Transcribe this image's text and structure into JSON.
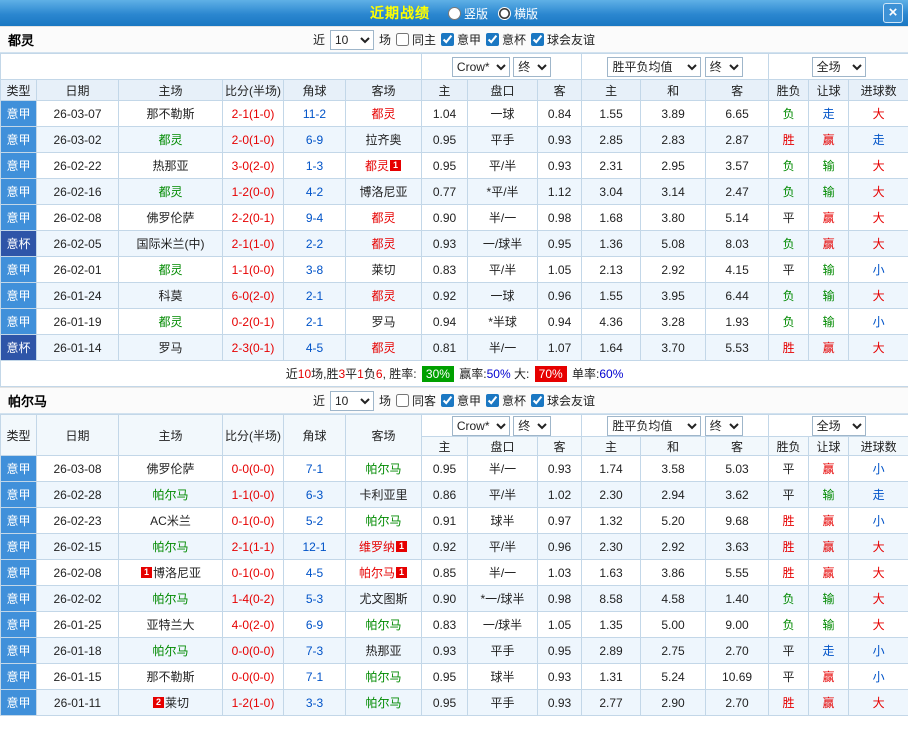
{
  "titlebar": {
    "title": "近期战绩",
    "vertical_label": "竖版",
    "horizontal_label": "横版",
    "horizontal_checked": true,
    "vertical_checked": false,
    "close_glyph": "×"
  },
  "colors": {
    "bar_blue": "#1a77c2",
    "title_yellow": "#ffff00",
    "league_badge": "#4090da",
    "cup_badge": "#2e55a8",
    "win_red": "#e60000",
    "loss_green": "#008a00",
    "link_blue": "#0053c8"
  },
  "sections": [
    {
      "team": "都灵",
      "filters": {
        "near": "近",
        "count": "10",
        "games": "场",
        "same": "同主",
        "same_checked": false,
        "league": "意甲",
        "league_checked": true,
        "cup": "意杯",
        "cup_checked": true,
        "friendly": "球会友谊",
        "friendly_checked": true
      },
      "dropdowns": {
        "company": "Crow*",
        "final1": "终",
        "avg": "胜平负均值",
        "final2": "终",
        "scope": "全场"
      },
      "columns": [
        "类型",
        "日期",
        "主场",
        "比分(半场)",
        "角球",
        "客场",
        "主",
        "盘口",
        "客",
        "主",
        "和",
        "客",
        "胜负",
        "让球",
        "进球数"
      ],
      "rows": [
        {
          "type": "意甲",
          "type_cls": "league",
          "date": "26-03-07",
          "home": "那不勒斯",
          "home_c": "black",
          "home_badge": "",
          "score": "2-1(1-0)",
          "corner": "11-2",
          "away": "都灵",
          "away_c": "red",
          "away_badge": "",
          "h": "1.04",
          "line": "一球",
          "a": "0.84",
          "w": "1.55",
          "d": "3.89",
          "l": "6.65",
          "res": "负",
          "res_c": "green",
          "hcp": "走",
          "hcp_c": "blue",
          "ou": "大",
          "ou_c": "red"
        },
        {
          "type": "意甲",
          "type_cls": "league",
          "date": "26-03-02",
          "home": "都灵",
          "home_c": "green",
          "home_badge": "",
          "score": "2-0(1-0)",
          "corner": "6-9",
          "away": "拉齐奥",
          "away_c": "black",
          "away_badge": "",
          "h": "0.95",
          "line": "平手",
          "a": "0.93",
          "w": "2.85",
          "d": "2.83",
          "l": "2.87",
          "res": "胜",
          "res_c": "red",
          "hcp": "赢",
          "hcp_c": "red",
          "ou": "走",
          "ou_c": "blue"
        },
        {
          "type": "意甲",
          "type_cls": "league",
          "date": "26-02-22",
          "home": "热那亚",
          "home_c": "black",
          "home_badge": "",
          "score": "3-0(2-0)",
          "corner": "1-3",
          "away": "都灵",
          "away_c": "red",
          "away_badge": "1",
          "h": "0.95",
          "line": "平/半",
          "a": "0.93",
          "w": "2.31",
          "d": "2.95",
          "l": "3.57",
          "res": "负",
          "res_c": "green",
          "hcp": "输",
          "hcp_c": "green",
          "ou": "大",
          "ou_c": "red"
        },
        {
          "type": "意甲",
          "type_cls": "league",
          "date": "26-02-16",
          "home": "都灵",
          "home_c": "green",
          "home_badge": "",
          "score": "1-2(0-0)",
          "corner": "4-2",
          "away": "博洛尼亚",
          "away_c": "black",
          "away_badge": "",
          "h": "0.77",
          "line": "*平/半",
          "a": "1.12",
          "w": "3.04",
          "d": "3.14",
          "l": "2.47",
          "res": "负",
          "res_c": "green",
          "hcp": "输",
          "hcp_c": "green",
          "ou": "大",
          "ou_c": "red"
        },
        {
          "type": "意甲",
          "type_cls": "league",
          "date": "26-02-08",
          "home": "佛罗伦萨",
          "home_c": "black",
          "home_badge": "",
          "score": "2-2(0-1)",
          "corner": "9-4",
          "away": "都灵",
          "away_c": "red",
          "away_badge": "",
          "h": "0.90",
          "line": "半/一",
          "a": "0.98",
          "w": "1.68",
          "d": "3.80",
          "l": "5.14",
          "res": "平",
          "res_c": "black",
          "hcp": "赢",
          "hcp_c": "red",
          "ou": "大",
          "ou_c": "red"
        },
        {
          "type": "意杯",
          "type_cls": "cup",
          "date": "26-02-05",
          "home": "国际米兰(中)",
          "home_c": "black",
          "home_badge": "",
          "score": "2-1(1-0)",
          "corner": "2-2",
          "away": "都灵",
          "away_c": "red",
          "away_badge": "",
          "h": "0.93",
          "line": "一/球半",
          "a": "0.95",
          "w": "1.36",
          "d": "5.08",
          "l": "8.03",
          "res": "负",
          "res_c": "green",
          "hcp": "赢",
          "hcp_c": "red",
          "ou": "大",
          "ou_c": "red"
        },
        {
          "type": "意甲",
          "type_cls": "league",
          "date": "26-02-01",
          "home": "都灵",
          "home_c": "green",
          "home_badge": "",
          "score": "1-1(0-0)",
          "corner": "3-8",
          "away": "莱切",
          "away_c": "black",
          "away_badge": "",
          "h": "0.83",
          "line": "平/半",
          "a": "1.05",
          "w": "2.13",
          "d": "2.92",
          "l": "4.15",
          "res": "平",
          "res_c": "black",
          "hcp": "输",
          "hcp_c": "green",
          "ou": "小",
          "ou_c": "blue"
        },
        {
          "type": "意甲",
          "type_cls": "league",
          "date": "26-01-24",
          "home": "科莫",
          "home_c": "black",
          "home_badge": "",
          "score": "6-0(2-0)",
          "corner": "2-1",
          "away": "都灵",
          "away_c": "red",
          "away_badge": "",
          "h": "0.92",
          "line": "一球",
          "a": "0.96",
          "w": "1.55",
          "d": "3.95",
          "l": "6.44",
          "res": "负",
          "res_c": "green",
          "hcp": "输",
          "hcp_c": "green",
          "ou": "大",
          "ou_c": "red"
        },
        {
          "type": "意甲",
          "type_cls": "league",
          "date": "26-01-19",
          "home": "都灵",
          "home_c": "green",
          "home_badge": "",
          "score": "0-2(0-1)",
          "corner": "2-1",
          "away": "罗马",
          "away_c": "black",
          "away_badge": "",
          "h": "0.94",
          "line": "*半球",
          "a": "0.94",
          "w": "4.36",
          "d": "3.28",
          "l": "1.93",
          "res": "负",
          "res_c": "green",
          "hcp": "输",
          "hcp_c": "green",
          "ou": "小",
          "ou_c": "blue"
        },
        {
          "type": "意杯",
          "type_cls": "cup",
          "date": "26-01-14",
          "home": "罗马",
          "home_c": "black",
          "home_badge": "",
          "score": "2-3(0-1)",
          "corner": "4-5",
          "away": "都灵",
          "away_c": "red",
          "away_badge": "",
          "h": "0.81",
          "line": "半/一",
          "a": "1.07",
          "w": "1.64",
          "d": "3.70",
          "l": "5.53",
          "res": "胜",
          "res_c": "red",
          "hcp": "赢",
          "hcp_c": "red",
          "ou": "大",
          "ou_c": "red"
        }
      ],
      "summary": [
        {
          "t": "近"
        },
        {
          "t": "10",
          "c": "txt-red"
        },
        {
          "t": "场,胜"
        },
        {
          "t": "3",
          "c": "txt-red"
        },
        {
          "t": "平"
        },
        {
          "t": "1",
          "c": "txt-red"
        },
        {
          "t": "负"
        },
        {
          "t": "6",
          "c": "txt-red"
        },
        {
          "t": ", 胜率: "
        },
        {
          "t": "30%",
          "c": "badge-green"
        },
        {
          "t": " 赢率:"
        },
        {
          "t": "50%",
          "c": "txt-blue"
        },
        {
          "t": " 大: "
        },
        {
          "t": "70%",
          "c": "badge-red"
        },
        {
          "t": " 单率:"
        },
        {
          "t": "60%",
          "c": "txt-blue"
        }
      ]
    },
    {
      "team": "帕尔马",
      "filters": {
        "near": "近",
        "count": "10",
        "games": "场",
        "same": "同客",
        "same_checked": false,
        "league": "意甲",
        "league_checked": true,
        "cup": "意杯",
        "cup_checked": true,
        "friendly": "球会友谊",
        "friendly_checked": true
      },
      "dropdowns": {
        "company": "Crow*",
        "final1": "终",
        "avg": "胜平负均值",
        "final2": "终",
        "scope": "全场"
      },
      "columns": [
        "类型",
        "日期",
        "主场",
        "比分(半场)",
        "角球",
        "客场",
        "主",
        "盘口",
        "客",
        "主",
        "和",
        "客",
        "胜负",
        "让球",
        "进球数"
      ],
      "rows": [
        {
          "type": "意甲",
          "type_cls": "league",
          "date": "26-03-08",
          "home": "佛罗伦萨",
          "home_c": "black",
          "home_badge": "",
          "score": "0-0(0-0)",
          "corner": "7-1",
          "away": "帕尔马",
          "away_c": "green",
          "away_badge": "",
          "h": "0.95",
          "line": "半/一",
          "a": "0.93",
          "w": "1.74",
          "d": "3.58",
          "l": "5.03",
          "res": "平",
          "res_c": "black",
          "hcp": "赢",
          "hcp_c": "red",
          "ou": "小",
          "ou_c": "blue"
        },
        {
          "type": "意甲",
          "type_cls": "league",
          "date": "26-02-28",
          "home": "帕尔马",
          "home_c": "green",
          "home_badge": "",
          "score": "1-1(0-0)",
          "corner": "6-3",
          "away": "卡利亚里",
          "away_c": "black",
          "away_badge": "",
          "h": "0.86",
          "line": "平/半",
          "a": "1.02",
          "w": "2.30",
          "d": "2.94",
          "l": "3.62",
          "res": "平",
          "res_c": "black",
          "hcp": "输",
          "hcp_c": "green",
          "ou": "走",
          "ou_c": "blue"
        },
        {
          "type": "意甲",
          "type_cls": "league",
          "date": "26-02-23",
          "home": "AC米兰",
          "home_c": "black",
          "home_badge": "",
          "score": "0-1(0-0)",
          "corner": "5-2",
          "away": "帕尔马",
          "away_c": "green",
          "away_badge": "",
          "h": "0.91",
          "line": "球半",
          "a": "0.97",
          "w": "1.32",
          "d": "5.20",
          "l": "9.68",
          "res": "胜",
          "res_c": "red",
          "hcp": "赢",
          "hcp_c": "red",
          "ou": "小",
          "ou_c": "blue"
        },
        {
          "type": "意甲",
          "type_cls": "league",
          "date": "26-02-15",
          "home": "帕尔马",
          "home_c": "green",
          "home_badge": "",
          "score": "2-1(1-1)",
          "corner": "12-1",
          "away": "维罗纳",
          "away_c": "red",
          "away_badge": "1",
          "h": "0.92",
          "line": "平/半",
          "a": "0.96",
          "w": "2.30",
          "d": "2.92",
          "l": "3.63",
          "res": "胜",
          "res_c": "red",
          "hcp": "赢",
          "hcp_c": "red",
          "ou": "大",
          "ou_c": "red"
        },
        {
          "type": "意甲",
          "type_cls": "league",
          "date": "26-02-08",
          "home": "博洛尼亚",
          "home_c": "black",
          "home_badge": "1",
          "score": "0-1(0-0)",
          "corner": "4-5",
          "away": "帕尔马",
          "away_c": "red",
          "away_badge": "1",
          "h": "0.85",
          "line": "半/一",
          "a": "1.03",
          "w": "1.63",
          "d": "3.86",
          "l": "5.55",
          "res": "胜",
          "res_c": "red",
          "hcp": "赢",
          "hcp_c": "red",
          "ou": "大",
          "ou_c": "red"
        },
        {
          "type": "意甲",
          "type_cls": "league",
          "date": "26-02-02",
          "home": "帕尔马",
          "home_c": "green",
          "home_badge": "",
          "score": "1-4(0-2)",
          "corner": "5-3",
          "away": "尤文图斯",
          "away_c": "black",
          "away_badge": "",
          "h": "0.90",
          "line": "*一/球半",
          "a": "0.98",
          "w": "8.58",
          "d": "4.58",
          "l": "1.40",
          "res": "负",
          "res_c": "green",
          "hcp": "输",
          "hcp_c": "green",
          "ou": "大",
          "ou_c": "red"
        },
        {
          "type": "意甲",
          "type_cls": "league",
          "date": "26-01-25",
          "home": "亚特兰大",
          "home_c": "black",
          "home_badge": "",
          "score": "4-0(2-0)",
          "corner": "6-9",
          "away": "帕尔马",
          "away_c": "green",
          "away_badge": "",
          "h": "0.83",
          "line": "一/球半",
          "a": "1.05",
          "w": "1.35",
          "d": "5.00",
          "l": "9.00",
          "res": "负",
          "res_c": "green",
          "hcp": "输",
          "hcp_c": "green",
          "ou": "大",
          "ou_c": "red"
        },
        {
          "type": "意甲",
          "type_cls": "league",
          "date": "26-01-18",
          "home": "帕尔马",
          "home_c": "green",
          "home_badge": "",
          "score": "0-0(0-0)",
          "corner": "7-3",
          "away": "热那亚",
          "away_c": "black",
          "away_badge": "",
          "h": "0.93",
          "line": "平手",
          "a": "0.95",
          "w": "2.89",
          "d": "2.75",
          "l": "2.70",
          "res": "平",
          "res_c": "black",
          "hcp": "走",
          "hcp_c": "blue",
          "ou": "小",
          "ou_c": "blue"
        },
        {
          "type": "意甲",
          "type_cls": "league",
          "date": "26-01-15",
          "home": "那不勒斯",
          "home_c": "black",
          "home_badge": "",
          "score": "0-0(0-0)",
          "corner": "7-1",
          "away": "帕尔马",
          "away_c": "green",
          "away_badge": "",
          "h": "0.95",
          "line": "球半",
          "a": "0.93",
          "w": "1.31",
          "d": "5.24",
          "l": "10.69",
          "res": "平",
          "res_c": "black",
          "hcp": "赢",
          "hcp_c": "red",
          "ou": "小",
          "ou_c": "blue"
        },
        {
          "type": "意甲",
          "type_cls": "league",
          "date": "26-01-11",
          "home": "莱切",
          "home_c": "black",
          "home_badge": "2",
          "score": "1-2(1-0)",
          "corner": "3-3",
          "away": "帕尔马",
          "away_c": "green",
          "away_badge": "",
          "h": "0.95",
          "line": "平手",
          "a": "0.93",
          "w": "2.77",
          "d": "2.90",
          "l": "2.70",
          "res": "胜",
          "res_c": "red",
          "hcp": "赢",
          "hcp_c": "red",
          "ou": "大",
          "ou_c": "red"
        }
      ]
    }
  ]
}
